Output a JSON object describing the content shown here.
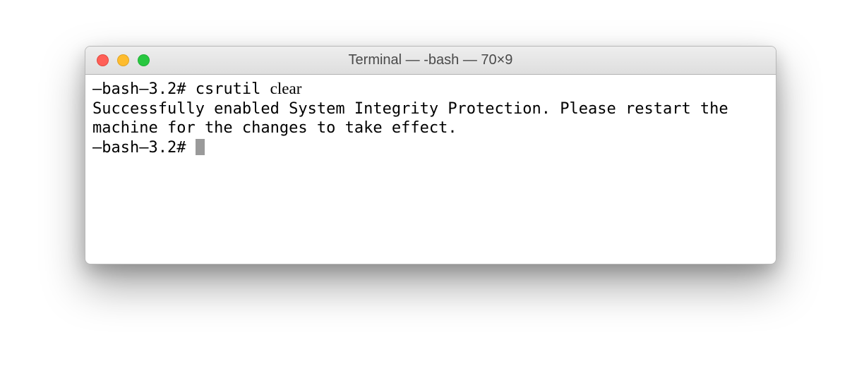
{
  "window": {
    "title": "Terminal — -bash — 70×9"
  },
  "terminal": {
    "line1_prompt": "–bash–3.2# ",
    "line1_cmd_mono": "csrutil ",
    "line1_cmd_serif": "clear",
    "output": "Successfully enabled System Integrity Protection. Please restart the machine for the changes to take effect.",
    "line2_prompt": "–bash–3.2# "
  }
}
